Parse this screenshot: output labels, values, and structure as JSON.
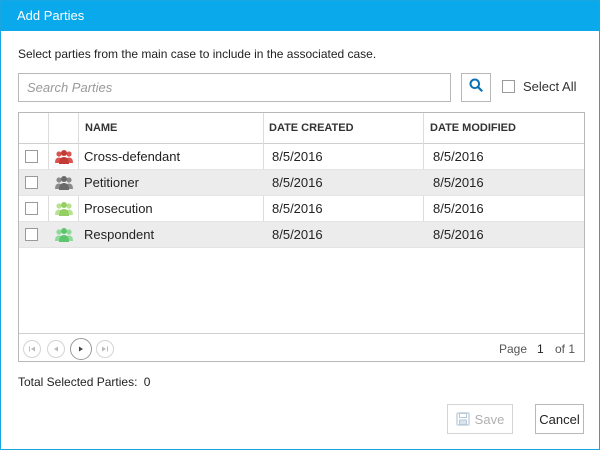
{
  "dialog": {
    "title": "Add Parties",
    "instructions": "Select parties from the main case to include in the associated case.",
    "accent_color": "#09a9ec"
  },
  "search": {
    "placeholder": "Search Parties",
    "value": "",
    "button_icon": "search-icon",
    "select_all_label": "Select All",
    "select_all_checked": false
  },
  "grid": {
    "columns": [
      "NAME",
      "DATE CREATED",
      "DATE MODIFIED"
    ],
    "rows": [
      {
        "name": "Cross-defendant",
        "date_created": "8/5/2016",
        "date_modified": "8/5/2016",
        "icon": "people-icon",
        "icon_color": "#d9534f",
        "checked": false
      },
      {
        "name": "Petitioner",
        "date_created": "8/5/2016",
        "date_modified": "8/5/2016",
        "icon": "people-icon",
        "icon_color": "#7a7a7a",
        "checked": false
      },
      {
        "name": "Prosecution",
        "date_created": "8/5/2016",
        "date_modified": "8/5/2016",
        "icon": "people-icon",
        "icon_color": "#a3d977",
        "checked": false
      },
      {
        "name": "Respondent",
        "date_created": "8/5/2016",
        "date_modified": "8/5/2016",
        "icon": "people-icon",
        "icon_color": "#6fcf7f",
        "checked": false
      }
    ]
  },
  "pager": {
    "page_label": "Page",
    "current_page": "1",
    "of_label": "of 1"
  },
  "footer": {
    "total_label": "Total Selected Parties:",
    "total_value": "0",
    "save_label": "Save",
    "cancel_label": "Cancel"
  }
}
